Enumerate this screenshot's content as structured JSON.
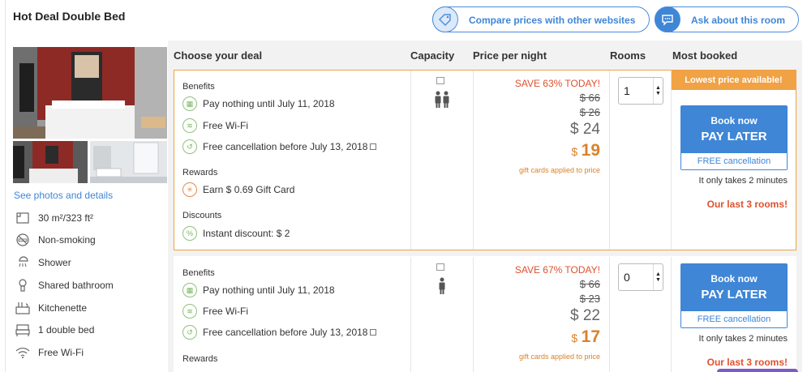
{
  "room": {
    "title": "Hot Deal Double Bed"
  },
  "actions": {
    "compare_label": "Compare prices with other websites",
    "ask_label": "Ask about this room"
  },
  "photos": {
    "see_link": "See photos and details"
  },
  "amenities": [
    {
      "icon": "room-size-icon",
      "label": "30 m²/323 ft²"
    },
    {
      "icon": "non-smoking-icon",
      "label": "Non-smoking"
    },
    {
      "icon": "shower-icon",
      "label": "Shower"
    },
    {
      "icon": "bathroom-icon",
      "label": "Shared bathroom"
    },
    {
      "icon": "kitchenette-icon",
      "label": "Kitchenette"
    },
    {
      "icon": "bed-icon",
      "label": "1 double bed"
    },
    {
      "icon": "wifi-icon",
      "label": "Free Wi-Fi"
    }
  ],
  "columns": {
    "deal": "Choose your deal",
    "capacity": "Capacity",
    "price": "Price per night",
    "rooms": "Rooms",
    "booked": "Most booked"
  },
  "deals": [
    {
      "benefits_title": "Benefits",
      "benefits": [
        "Pay nothing until July 11, 2018",
        "Free Wi-Fi",
        "Free cancellation before July 13, 2018"
      ],
      "rewards_title": "Rewards",
      "reward": "Earn $ 0.69 Gift Card",
      "discounts_title": "Discounts",
      "discount": "Instant discount: $ 2",
      "save": "SAVE 63% TODAY!",
      "strike1": "$ 66",
      "strike2": "$ 26",
      "price": "$ 24",
      "final_currency": "$",
      "final_amount": "19",
      "gift_note": "gift cards applied to price",
      "rooms_value": "1",
      "lowest": "Lowest price available!",
      "book_top": "Book now",
      "book_main": "PAY LATER",
      "book_cancel": "FREE cancellation",
      "takes": "It only takes 2 minutes",
      "last": "Our last 3 rooms!"
    },
    {
      "benefits_title": "Benefits",
      "benefits": [
        "Pay nothing until July 11, 2018",
        "Free Wi-Fi",
        "Free cancellation before July 13, 2018"
      ],
      "rewards_title": "Rewards",
      "save": "SAVE 67% TODAY!",
      "strike1": "$ 66",
      "strike2": "$ 23",
      "price": "$ 22",
      "final_currency": "$",
      "final_amount": "17",
      "gift_note": "gift cards applied to price",
      "rooms_value": "0",
      "book_top": "Book now",
      "book_main": "PAY LATER",
      "book_cancel": "FREE cancellation",
      "takes": "It only takes 2 minutes",
      "last": "Our last 3 rooms!"
    }
  ],
  "colors": {
    "accent": "#3f86d6",
    "highlight": "#f0a245",
    "alert": "#e0502d",
    "gift": "#d9822b"
  }
}
